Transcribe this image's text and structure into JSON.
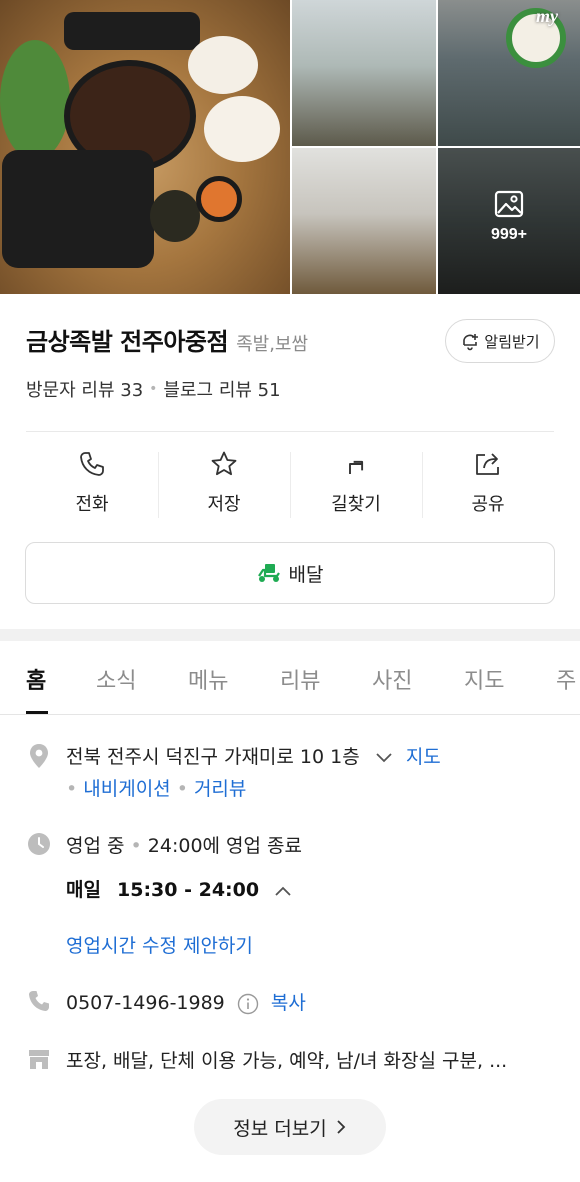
{
  "photos": {
    "more_count": "999+",
    "badge_text": "my"
  },
  "place": {
    "name": "금상족발 전주아중점",
    "category": "족발,보쌈",
    "alarm_label": "알림받기",
    "visitor_review": "방문자 리뷰 33",
    "blog_review": "블로그 리뷰 51"
  },
  "actions": {
    "call": "전화",
    "save": "저장",
    "directions": "길찾기",
    "share": "공유",
    "delivery": "배달"
  },
  "tabs": [
    "홈",
    "소식",
    "메뉴",
    "리뷰",
    "사진",
    "지도",
    "주"
  ],
  "info": {
    "address": "전북 전주시 덕진구 가재미로 10 1층",
    "map_link": "지도",
    "navigation_link": "내비게이션",
    "street_view_link": "거리뷰",
    "status": "영업 중",
    "closing": "24:00에 영업 종료",
    "hours_day": "매일",
    "hours_time": "15:30 - 24:00",
    "suggest_edit": "영업시간 수정 제안하기",
    "phone": "0507-1496-1989",
    "copy": "복사",
    "amenities": "포장, 배달, 단체 이용 가능, 예약, 남/녀 화장실 구분, ..."
  },
  "more_info_label": "정보 더보기",
  "colors": {
    "link": "#1f6ed4",
    "delivery_icon": "#1fab53"
  }
}
